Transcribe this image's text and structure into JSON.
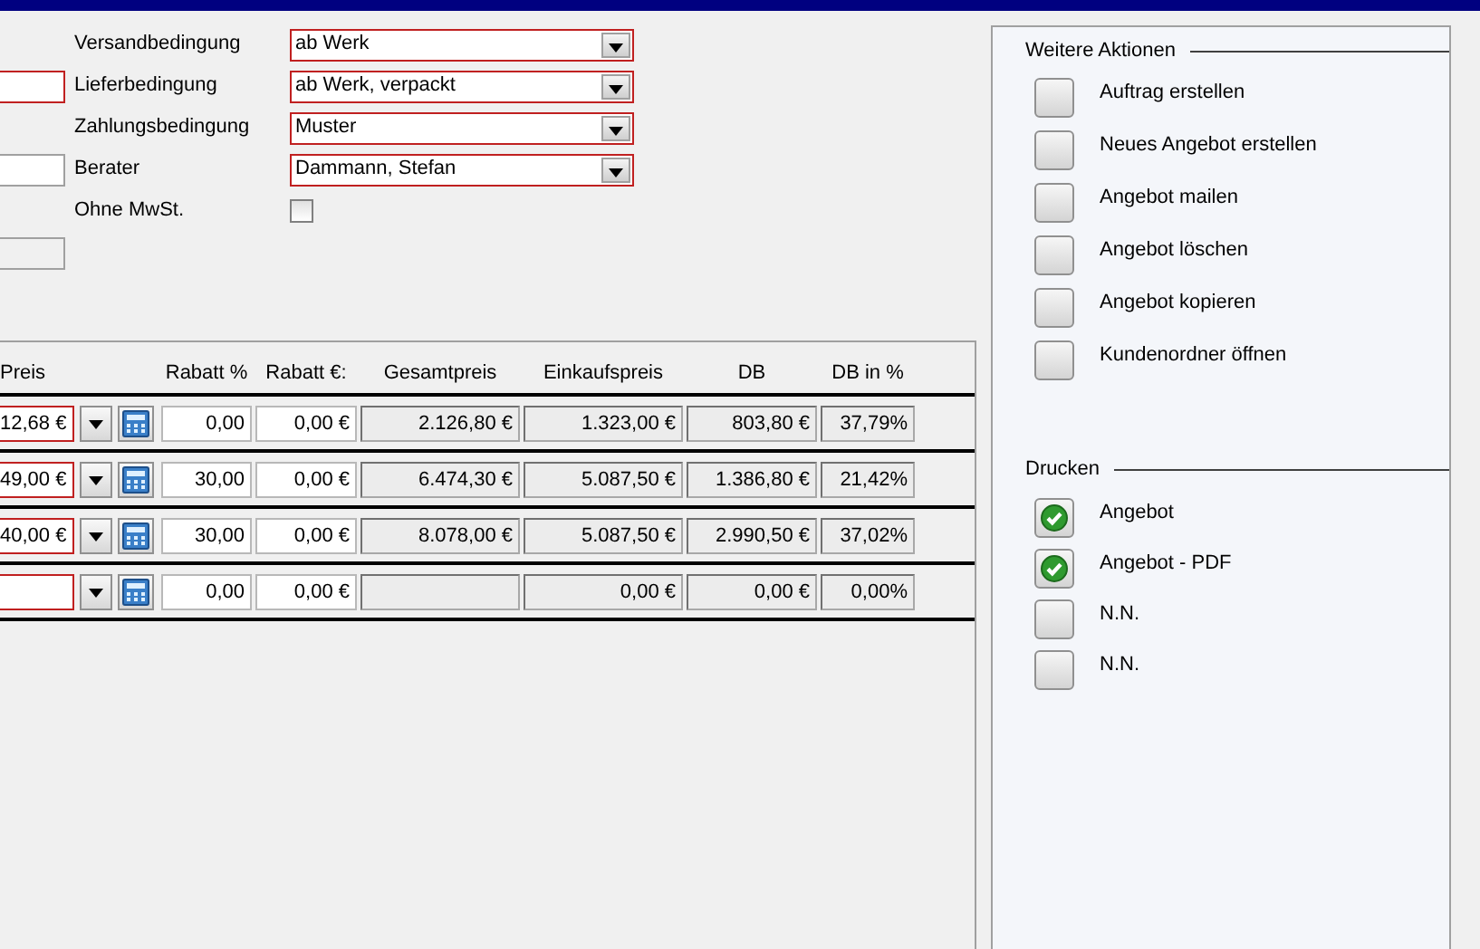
{
  "form_rows": [
    {
      "kind": "dropdown",
      "label": "Versandbedingung",
      "value": "ab Werk"
    },
    {
      "kind": "dropdown",
      "left_field": {
        "kind": "required"
      },
      "label": "Lieferbedingung",
      "value": "ab Werk, verpackt"
    },
    {
      "kind": "dropdown",
      "label": "Zahlungsbedingung",
      "value": "Muster"
    },
    {
      "kind": "dropdown",
      "left_field": {
        "kind": "plain"
      },
      "label": "Berater",
      "value": "Dammann, Stefan"
    },
    {
      "kind": "checkbox",
      "label": "Ohne MwSt.",
      "checked": false
    },
    {
      "kind": "empty",
      "left_field": {
        "kind": "disabled"
      }
    }
  ],
  "table": {
    "columns": [
      "Preis",
      "Rabatt %",
      "Rabatt €:",
      "Gesamtpreis",
      "Einkaufspreis",
      "DB",
      "DB in %"
    ],
    "rows": [
      {
        "preis": "12,68 €",
        "rabatt_pct": "0,00",
        "rabatt_eur": "0,00 €",
        "gesamtpreis": "2.126,80 €",
        "einkaufspreis": "1.323,00 €",
        "db": "803,80 €",
        "db_pct": "37,79%"
      },
      {
        "preis": "49,00 €",
        "rabatt_pct": "30,00",
        "rabatt_eur": "0,00 €",
        "gesamtpreis": "6.474,30 €",
        "einkaufspreis": "5.087,50 €",
        "db": "1.386,80 €",
        "db_pct": "21,42%"
      },
      {
        "preis": "40,00 €",
        "rabatt_pct": "30,00",
        "rabatt_eur": "0,00 €",
        "gesamtpreis": "8.078,00 €",
        "einkaufspreis": "5.087,50 €",
        "db": "2.990,50 €",
        "db_pct": "37,02%"
      },
      {
        "rabatt_pct": "0,00",
        "rabatt_eur": "0,00 €",
        "einkaufspreis": "0,00 €",
        "db": "0,00 €",
        "db_pct": "0,00%"
      }
    ]
  },
  "actions": {
    "title": "Weitere Aktionen",
    "items": [
      "Auftrag erstellen",
      "Neues Angebot erstellen",
      "Angebot mailen",
      "Angebot löschen",
      "Angebot kopieren",
      "Kundenordner öffnen"
    ]
  },
  "print": {
    "title": "Drucken",
    "items": [
      {
        "label": "Angebot",
        "checked": true
      },
      {
        "label": "Angebot - PDF",
        "checked": true
      },
      {
        "label": "N.N.",
        "checked": false
      },
      {
        "label": "N.N.",
        "checked": false
      }
    ]
  }
}
